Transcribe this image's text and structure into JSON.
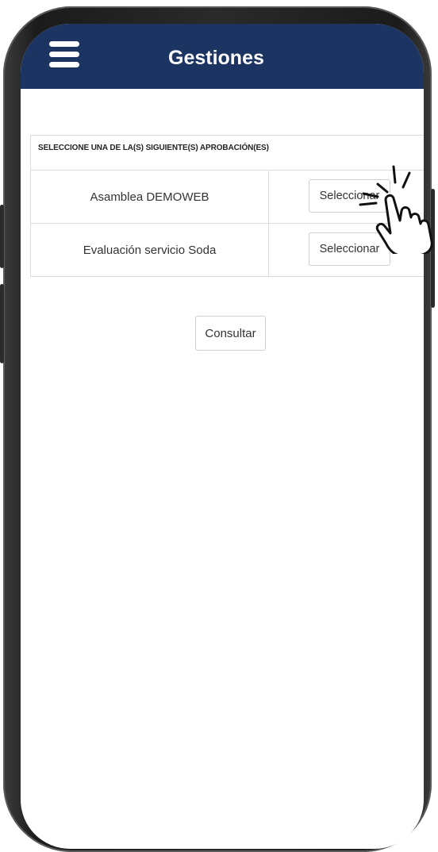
{
  "header": {
    "title": "Gestiones",
    "menu_icon": "hamburger-menu-icon"
  },
  "table": {
    "heading": "SELECCIONE UNA DE LA(S) SIGUIENTE(S) APROBACIÓN(ES)",
    "rows": [
      {
        "name": "Asamblea DEMOWEB",
        "action_label": "Seleccionar"
      },
      {
        "name": "Evaluación servicio Soda",
        "action_label": "Seleccionar"
      }
    ]
  },
  "consult_button": {
    "label": "Consultar"
  },
  "pointer_icon": "tapping-hand-icon",
  "colors": {
    "header_bg": "#1c3461",
    "header_text": "#ffffff"
  }
}
